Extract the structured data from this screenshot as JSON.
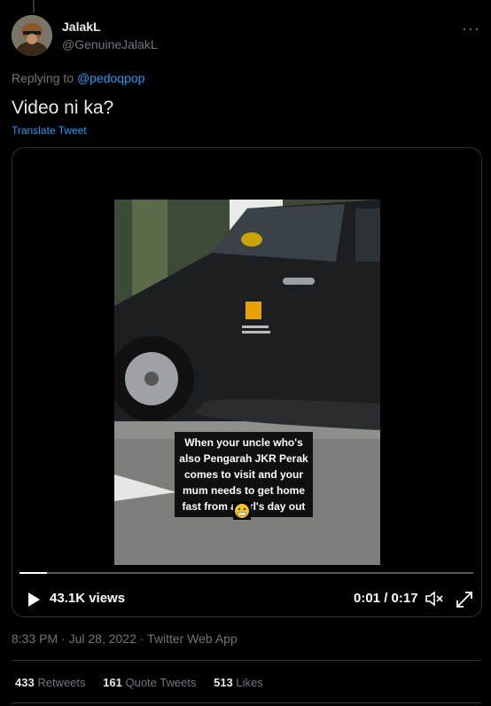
{
  "tweet": {
    "display_name": "JalakL",
    "handle": "@GenuineJalakL",
    "more_glyph": "···",
    "replying_prefix": "Replying to",
    "replying_to": "@pedoqpop",
    "text": "Video ni ka?",
    "translate_label": "Translate Tweet",
    "timestamp": "8:33 PM · Jul 28, 2022 · Twitter Web App"
  },
  "video": {
    "caption": "When your uncle who's also Pengarah JKR Perak comes to visit and your mum needs to get home fast from a girl's day out",
    "views": "43.1K views",
    "time": "0:01 / 0:17",
    "progress_fraction": 0.06
  },
  "stats": {
    "retweets_count": "433",
    "retweets_label": "Retweets",
    "quotes_count": "161",
    "quotes_label": "Quote Tweets",
    "likes_count": "513",
    "likes_label": "Likes"
  },
  "colors": {
    "accent": "#1d9bf0",
    "muted": "#71767b",
    "text": "#e7e9ea"
  }
}
